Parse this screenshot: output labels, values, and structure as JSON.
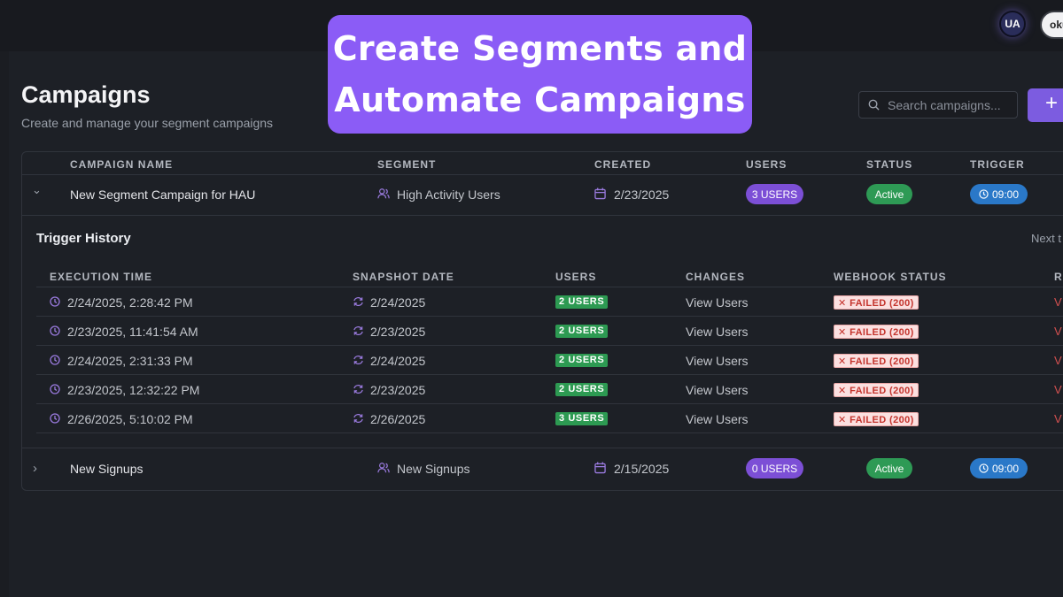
{
  "banner": {
    "line1": "Create Segments and",
    "line2": "Automate Campaigns"
  },
  "header": {
    "logo_text": "UA",
    "user_label": "oku",
    "accent": "#8b5cf6"
  },
  "page": {
    "title": "Campaigns",
    "subtitle": "Create and manage your segment campaigns"
  },
  "search": {
    "placeholder": "Search campaigns..."
  },
  "add_button": {
    "label": "+"
  },
  "table": {
    "columns": [
      "CAMPAIGN NAME",
      "SEGMENT",
      "CREATED",
      "USERS",
      "STATUS",
      "TRIGGER"
    ],
    "rows": [
      {
        "name": "New Segment Campaign for HAU",
        "segment": "High Activity Users",
        "created": "2/23/2025",
        "users": "3 USERS",
        "status": "Active",
        "trigger": "09:00",
        "expanded": true,
        "chevron": "⌄"
      },
      {
        "name": "New Signups",
        "segment": "New Signups",
        "created": "2/15/2025",
        "users": "0 USERS",
        "status": "Active",
        "trigger": "09:00",
        "expanded": false,
        "chevron": "›"
      }
    ]
  },
  "history": {
    "title": "Trigger History",
    "next_label": "Next t",
    "columns": [
      "EXECUTION TIME",
      "SNAPSHOT DATE",
      "USERS",
      "CHANGES",
      "WEBHOOK STATUS",
      "R"
    ],
    "rows": [
      {
        "time": "2/24/2025, 2:28:42 PM",
        "snapshot": "2/24/2025",
        "users": "2 USERS",
        "changes": "View Users",
        "webhook": "FAILED (200)",
        "r": "V"
      },
      {
        "time": "2/23/2025, 11:41:54 AM",
        "snapshot": "2/23/2025",
        "users": "2 USERS",
        "changes": "View Users",
        "webhook": "FAILED (200)",
        "r": "V"
      },
      {
        "time": "2/24/2025, 2:31:33 PM",
        "snapshot": "2/24/2025",
        "users": "2 USERS",
        "changes": "View Users",
        "webhook": "FAILED (200)",
        "r": "V"
      },
      {
        "time": "2/23/2025, 12:32:22 PM",
        "snapshot": "2/23/2025",
        "users": "2 USERS",
        "changes": "View Users",
        "webhook": "FAILED (200)",
        "r": "V"
      },
      {
        "time": "2/26/2025, 5:10:02 PM",
        "snapshot": "2/26/2025",
        "users": "3 USERS",
        "changes": "View Users",
        "webhook": "FAILED (200)",
        "r": "V"
      }
    ]
  },
  "colors": {
    "purple_badge": "#7c4fd6",
    "green_badge": "#2e9a55",
    "blue_badge": "#2a78c8",
    "failed_text": "#c4342d"
  }
}
